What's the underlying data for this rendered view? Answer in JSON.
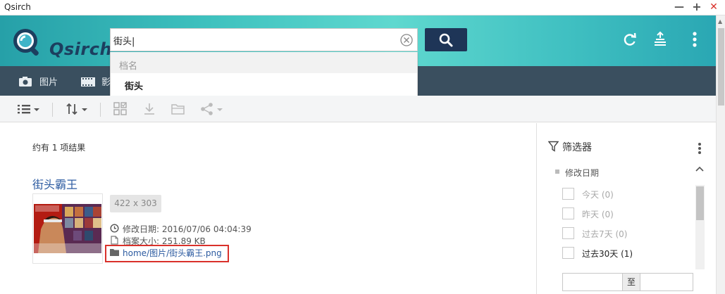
{
  "window": {
    "title": "Qsirch"
  },
  "header": {
    "logo_text": "Qsirch",
    "search": {
      "value": "街头|",
      "placeholder": ""
    },
    "colors": {
      "accent": "#3fc2bf",
      "search_button": "#1e3557"
    }
  },
  "categories": [
    {
      "label": "图片",
      "icon": "camera-icon"
    },
    {
      "label": "影",
      "icon": "film-icon"
    }
  ],
  "dropdown": {
    "header": "档名",
    "items": [
      "街头"
    ]
  },
  "results": {
    "count_text": "约有 1 项结果",
    "items": [
      {
        "title": "街头霸王",
        "dimensions": "422 x 303",
        "modified_label": "修改日期:",
        "modified_value": "2016/07/06 04:04:39",
        "size_label": "档案大小:",
        "size_value": "251.89 KB",
        "path": "home/图片/街头霸王.png"
      }
    ]
  },
  "filter": {
    "title": "筛选器",
    "group_label": "修改日期",
    "options": [
      {
        "label": "今天 (0)",
        "state": "disabled"
      },
      {
        "label": "昨天 (0)",
        "state": "disabled"
      },
      {
        "label": "过去7天 (0)",
        "state": "disabled"
      },
      {
        "label": "过去30天 (1)",
        "state": "enabled"
      }
    ],
    "range_separator": "至"
  }
}
